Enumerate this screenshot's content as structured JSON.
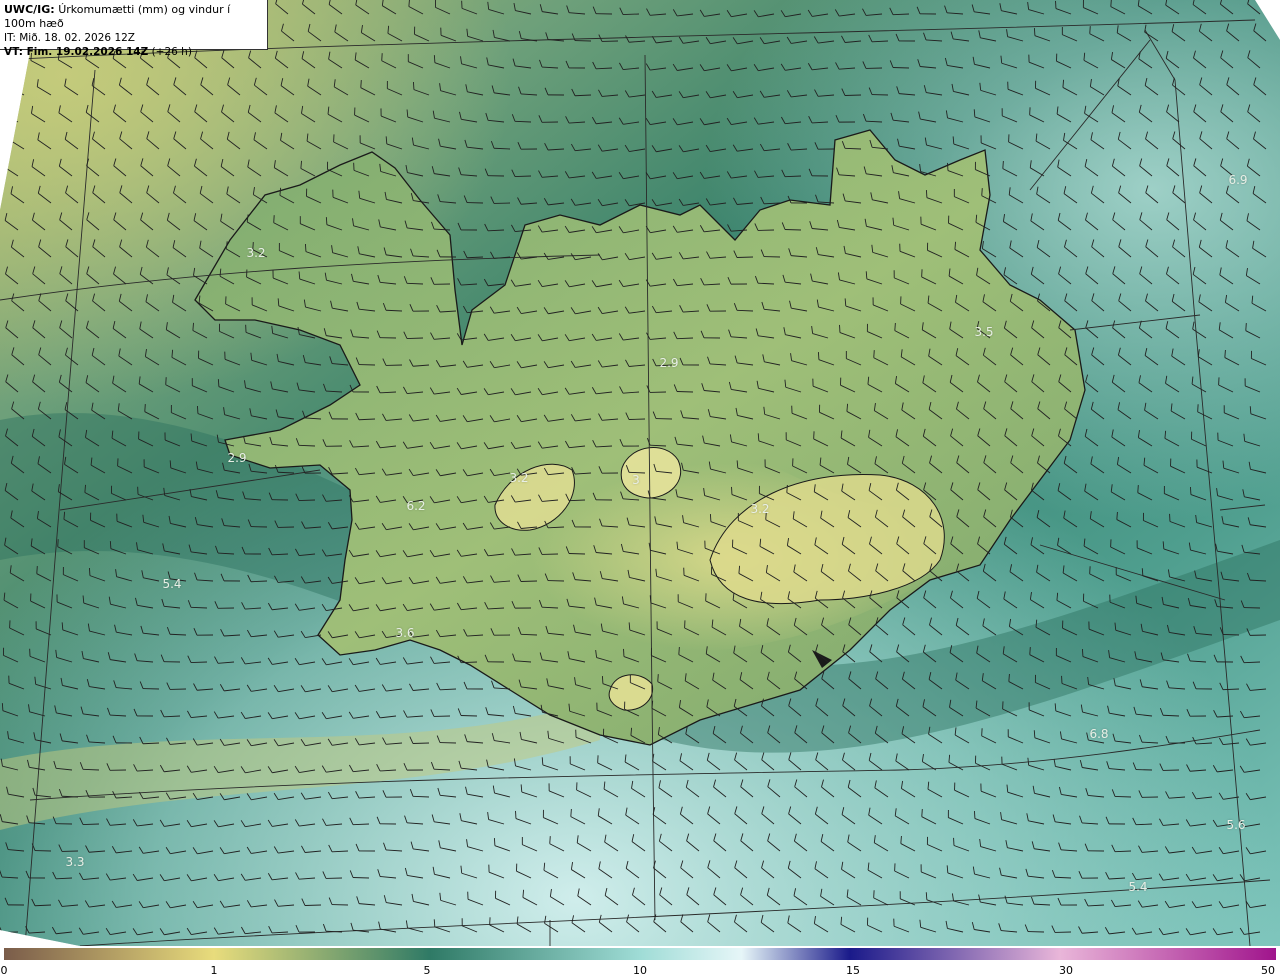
{
  "header": {
    "product_code": "UWC/IG:",
    "product_name": "Úrkomumætti (mm) og vindur í 100m hæð",
    "initial_time": "IT: Mið. 18. 02. 2026 12Z",
    "valid_label": "VT: Fim. 19.02.2026 14Z",
    "valid_offset": "(+26 h)"
  },
  "map": {
    "region": "Iceland",
    "field": "precipitable water",
    "units": "mm",
    "overlay": "wind barbs at 100 m",
    "value_labels": [
      {
        "text": "6.9"
      },
      {
        "text": "3.2"
      },
      {
        "text": "3.5"
      },
      {
        "text": "2.9"
      },
      {
        "text": "2.9"
      },
      {
        "text": "3.2"
      },
      {
        "text": "3"
      },
      {
        "text": "3.2"
      },
      {
        "text": "6.2"
      },
      {
        "text": "5.4"
      },
      {
        "text": "3.6"
      },
      {
        "text": "6.8"
      },
      {
        "text": "5.6"
      },
      {
        "text": "5.4"
      },
      {
        "text": "3.3"
      }
    ],
    "colors": {
      "coast": "#1a1a1a",
      "grid": "#2a2a2a",
      "barb": "#222222",
      "low_yellow": "#d6d98a",
      "mid_teal": "#2f7a66",
      "high_cyan": "#bfe3df"
    }
  },
  "colorbar": {
    "ticks": [
      "0",
      "1",
      "5",
      "10",
      "15",
      "30",
      "50"
    ],
    "stops": [
      "#7a5c4a",
      "#e8dc7c",
      "#2f7a66",
      "#9fdcd6",
      "#e6f6f8",
      "#1a1a8a",
      "#e9b6d9",
      "#a0148c"
    ]
  }
}
